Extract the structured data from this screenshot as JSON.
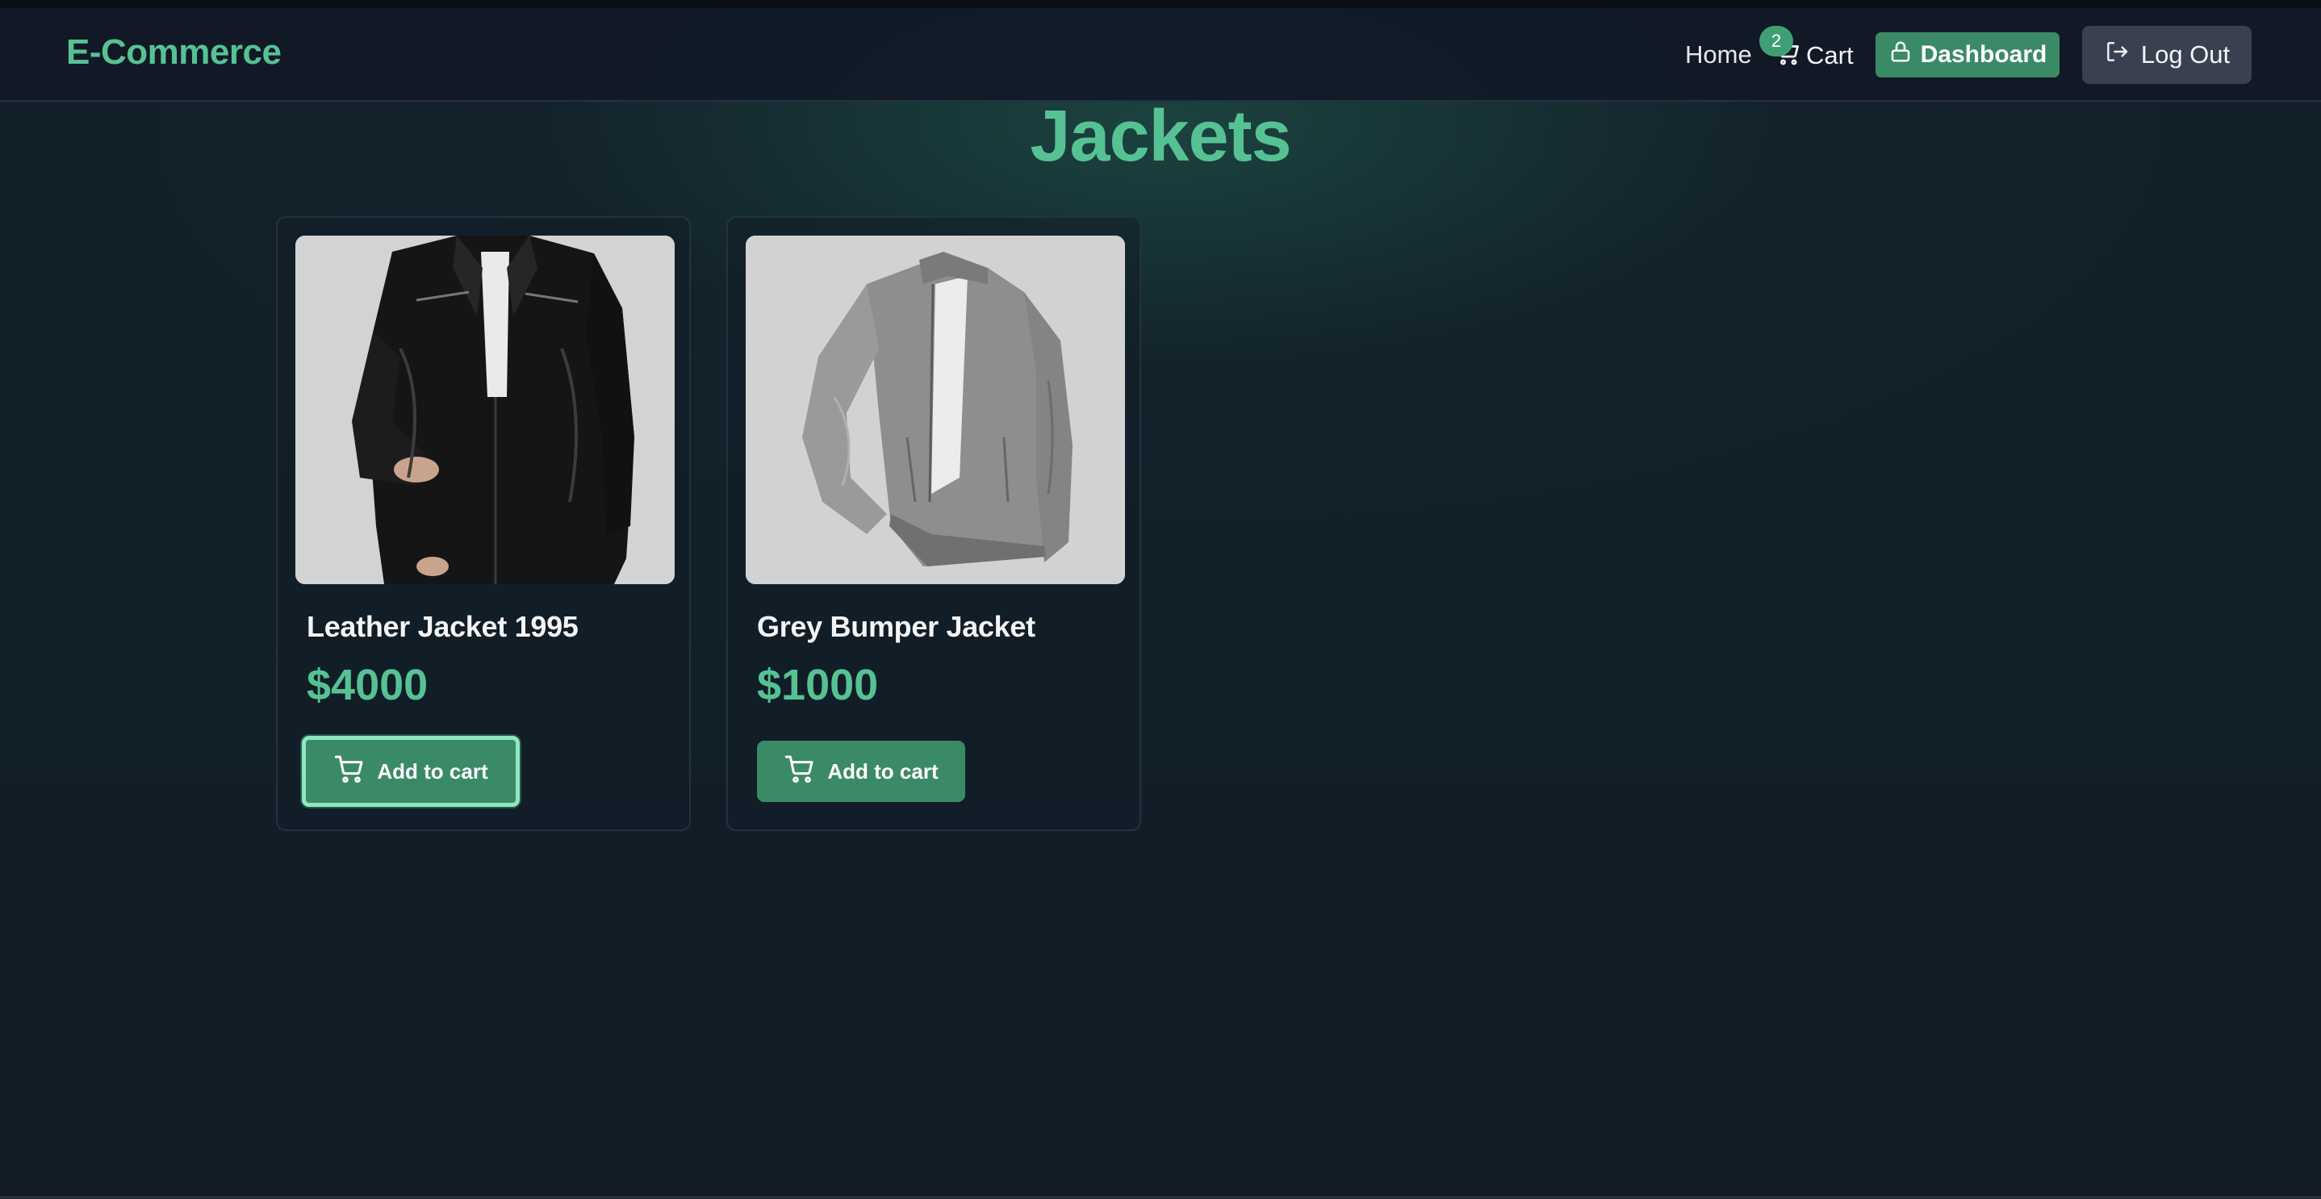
{
  "navbar": {
    "brand": "E-Commerce",
    "home_label": "Home",
    "cart_label": "Cart",
    "cart_count": "2",
    "dashboard_label": "Dashboard",
    "logout_label": "Log Out"
  },
  "page": {
    "title": "Jackets"
  },
  "products": [
    {
      "name": "Leather Jacket 1995",
      "price": "$4000",
      "add_label": "Add to cart",
      "image_icon": "leather-jacket-photo"
    },
    {
      "name": "Grey Bumper Jacket",
      "price": "$1000",
      "add_label": "Add to cart",
      "image_icon": "grey-jacket-photo"
    }
  ],
  "colors": {
    "accent": "#56c293",
    "button": "#3b8a66",
    "background": "#111c26",
    "logout_button": "#394150"
  }
}
